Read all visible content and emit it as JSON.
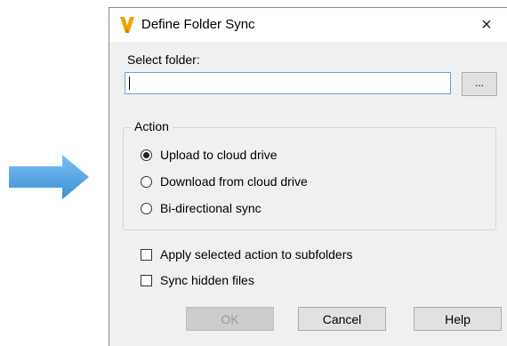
{
  "dialog": {
    "title": "Define Folder Sync",
    "close_glyph": "×",
    "logo_icon": "vault-logo-icon",
    "logo_color": "#f5a000",
    "select_folder_label": "Select folder:",
    "folder_value": "",
    "browse_label": "...",
    "action_group_title": "Action",
    "actions": [
      {
        "label": "Upload to cloud drive",
        "selected": true
      },
      {
        "label": "Download from cloud drive",
        "selected": false
      },
      {
        "label": "Bi-directional sync",
        "selected": false
      }
    ],
    "options": [
      {
        "label": "Apply selected action to subfolders",
        "checked": false
      },
      {
        "label": "Sync hidden files",
        "checked": false
      }
    ],
    "buttons": {
      "ok": "OK",
      "cancel": "Cancel",
      "help": "Help"
    },
    "ok_enabled": false
  },
  "arrow": {
    "icon": "arrow-right-icon",
    "color": "#5aa9e6"
  }
}
